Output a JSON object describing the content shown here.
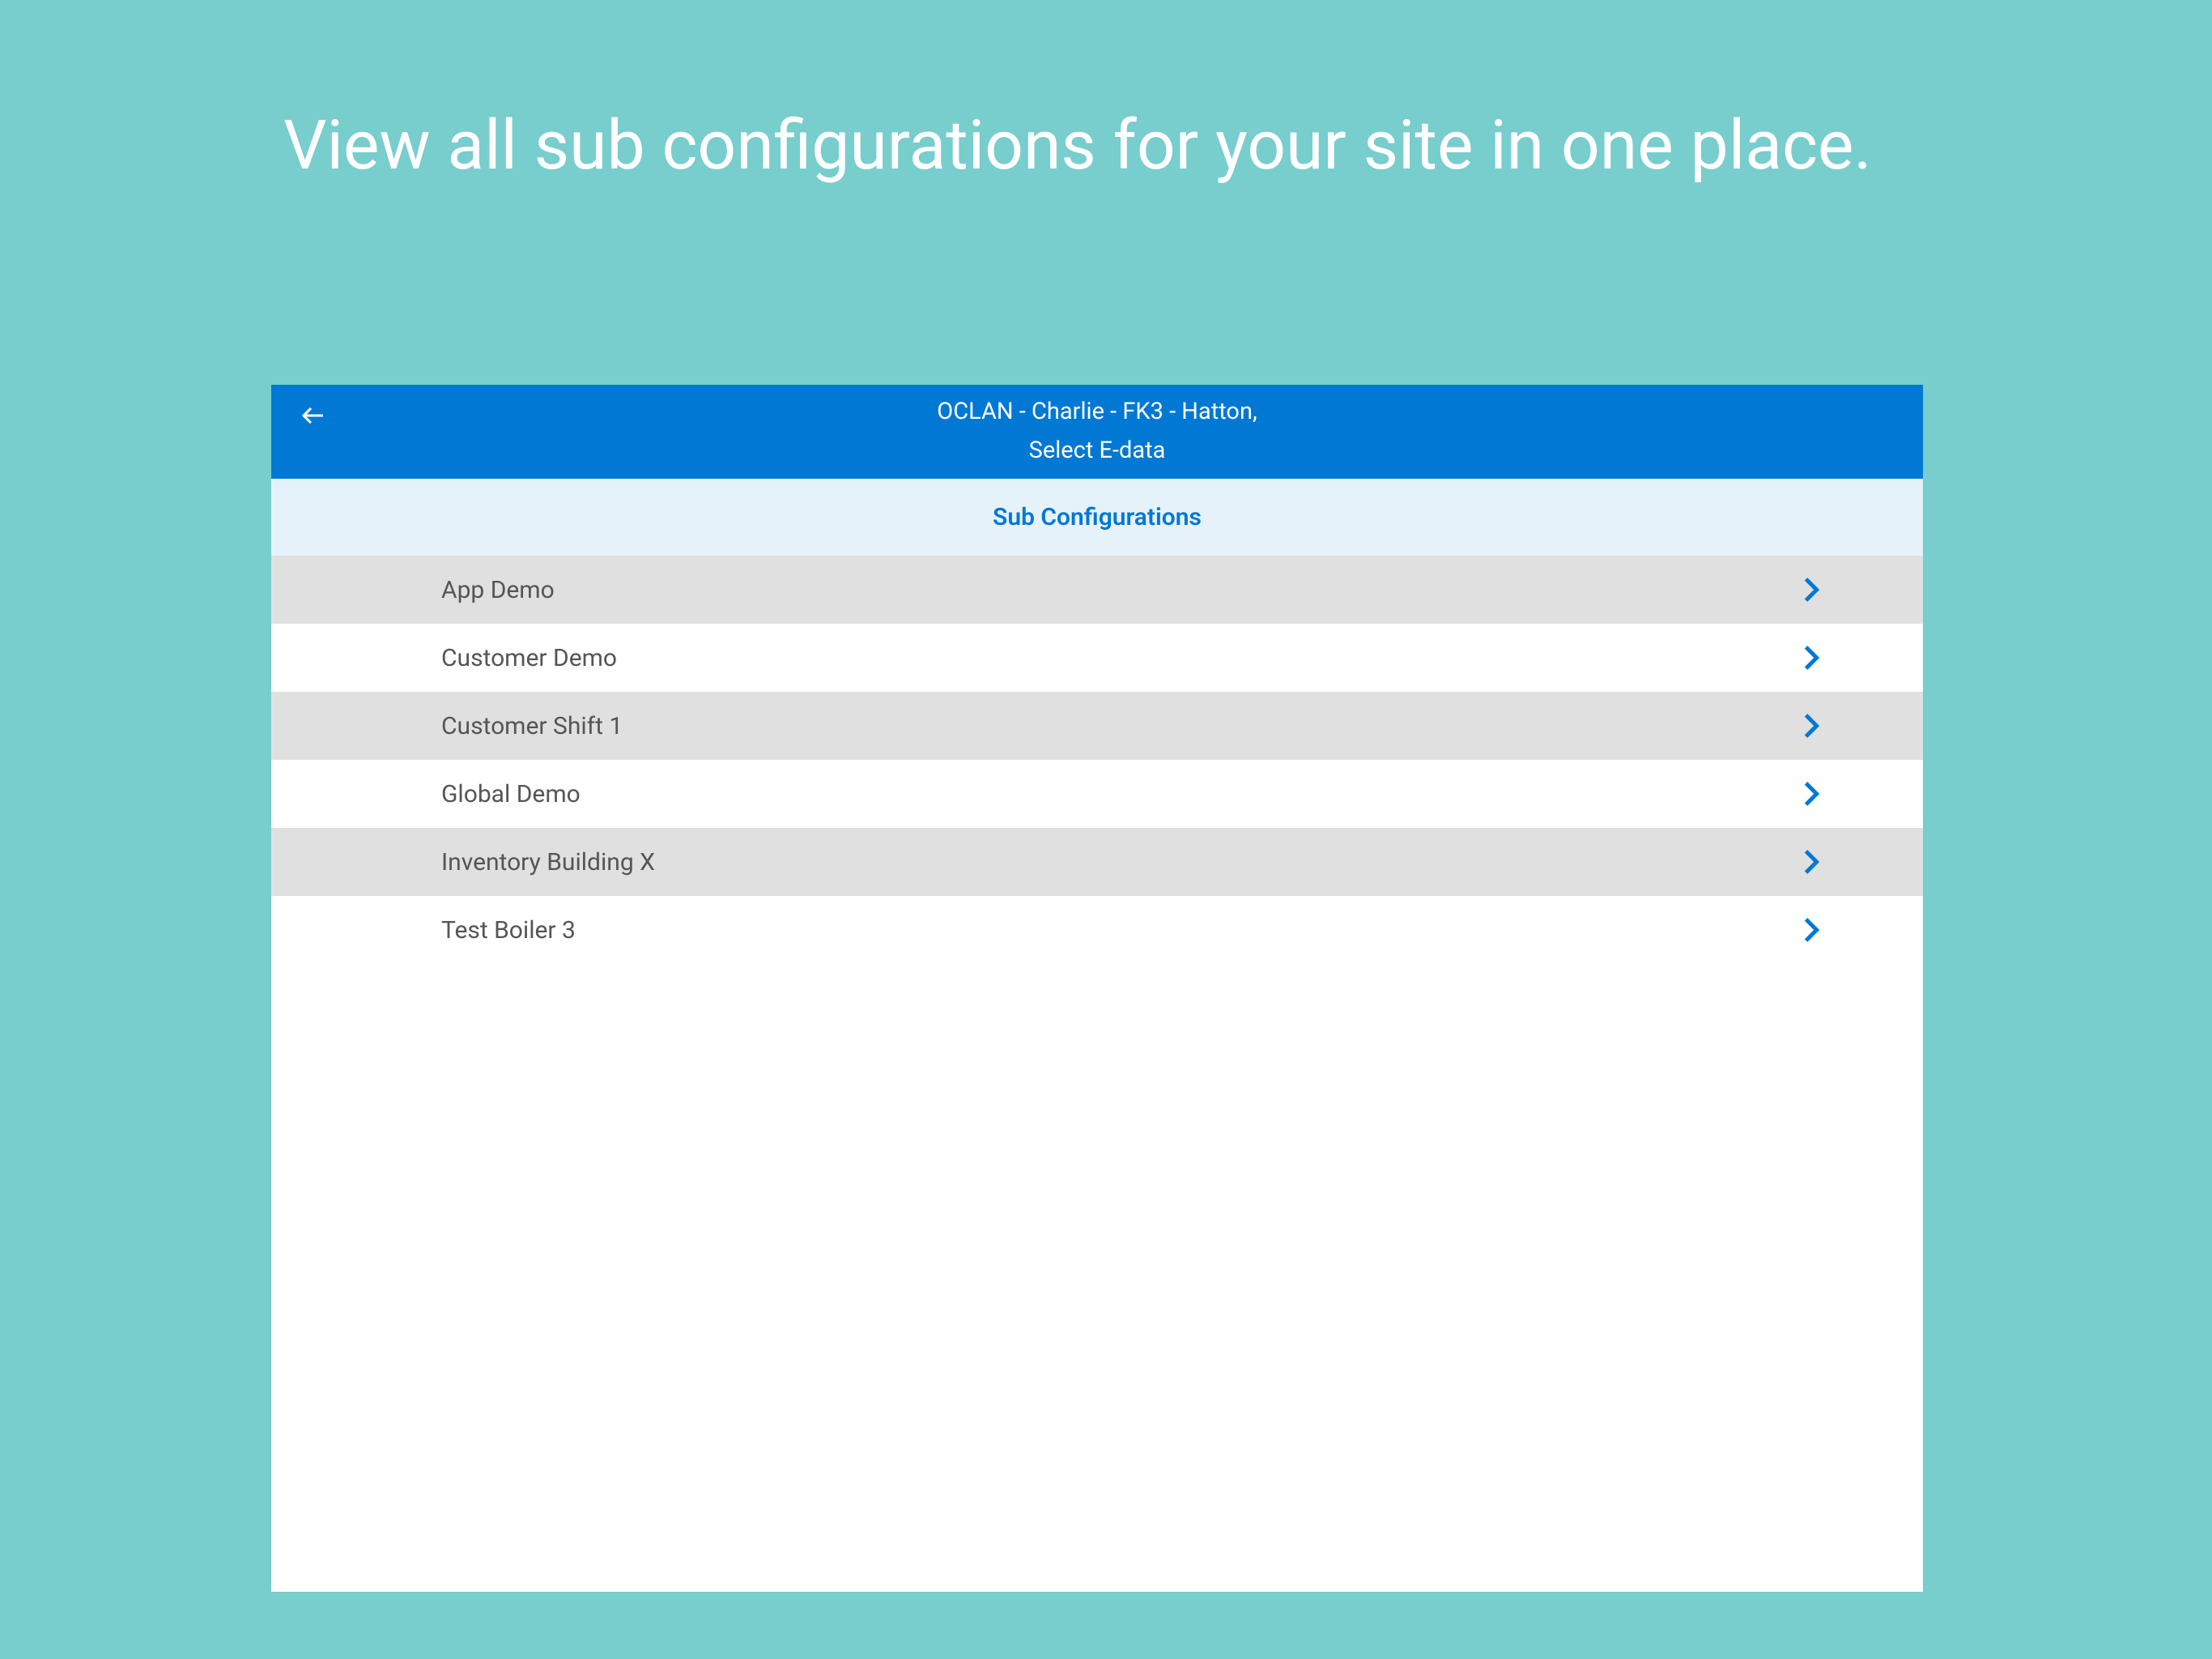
{
  "page": {
    "title": "View all sub configurations for your site in one place."
  },
  "header": {
    "breadcrumb": "OCLAN - Charlie - FK3 - Hatton,",
    "subtitle": "Select E-data"
  },
  "section": {
    "title": "Sub Configurations"
  },
  "list": {
    "items": [
      {
        "label": "App Demo"
      },
      {
        "label": "Customer Demo"
      },
      {
        "label": "Customer Shift 1"
      },
      {
        "label": "Global Demo"
      },
      {
        "label": "Inventory Building X"
      },
      {
        "label": "Test Boiler 3"
      }
    ]
  }
}
